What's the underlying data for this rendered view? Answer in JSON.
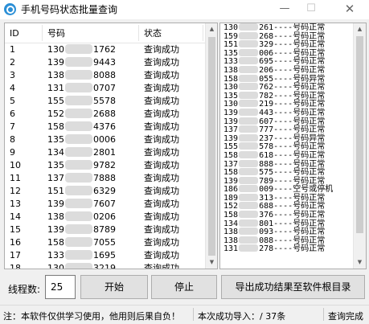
{
  "window": {
    "title": "手机号码状态批量查询",
    "minimize": "—",
    "maximize": "☐",
    "close": "✕",
    "icon": "app-search-icon"
  },
  "table": {
    "headers": [
      "ID",
      "号码",
      "状态"
    ],
    "rows": [
      {
        "id": "1",
        "prefix": "130",
        "suffix": "1762",
        "status": "查询成功"
      },
      {
        "id": "2",
        "prefix": "139",
        "suffix": "9443",
        "status": "查询成功"
      },
      {
        "id": "3",
        "prefix": "138",
        "suffix": "8088",
        "status": "查询成功"
      },
      {
        "id": "4",
        "prefix": "131",
        "suffix": "0707",
        "status": "查询成功"
      },
      {
        "id": "5",
        "prefix": "155",
        "suffix": "5578",
        "status": "查询成功"
      },
      {
        "id": "6",
        "prefix": "152",
        "suffix": "2688",
        "status": "查询成功"
      },
      {
        "id": "7",
        "prefix": "158",
        "suffix": "4376",
        "status": "查询成功"
      },
      {
        "id": "8",
        "prefix": "135",
        "suffix": "0006",
        "status": "查询成功"
      },
      {
        "id": "9",
        "prefix": "134",
        "suffix": "2801",
        "status": "查询成功"
      },
      {
        "id": "10",
        "prefix": "135",
        "suffix": "9782",
        "status": "查询成功"
      },
      {
        "id": "11",
        "prefix": "137",
        "suffix": "7888",
        "status": "查询成功"
      },
      {
        "id": "12",
        "prefix": "151",
        "suffix": "6329",
        "status": "查询成功"
      },
      {
        "id": "13",
        "prefix": "139",
        "suffix": "7607",
        "status": "查询成功"
      },
      {
        "id": "14",
        "prefix": "138",
        "suffix": "0206",
        "status": "查询成功"
      },
      {
        "id": "15",
        "prefix": "139",
        "suffix": "8789",
        "status": "查询成功"
      },
      {
        "id": "16",
        "prefix": "158",
        "suffix": "7055",
        "status": "查询成功"
      },
      {
        "id": "17",
        "prefix": "133",
        "suffix": "1695",
        "status": "查询成功"
      },
      {
        "id": "18",
        "prefix": "130",
        "suffix": "3219",
        "status": "查询成功"
      }
    ]
  },
  "results": [
    {
      "prefix": "130",
      "suffix": "261",
      "status": "号码正常"
    },
    {
      "prefix": "159",
      "suffix": "268",
      "status": "号码正常"
    },
    {
      "prefix": "151",
      "suffix": "329",
      "status": "号码正常"
    },
    {
      "prefix": "135",
      "suffix": "006",
      "status": "号码正常"
    },
    {
      "prefix": "133",
      "suffix": "695",
      "status": "号码正常"
    },
    {
      "prefix": "138",
      "suffix": "206",
      "status": "号码正常"
    },
    {
      "prefix": "158",
      "suffix": "055",
      "status": "号码异常"
    },
    {
      "prefix": "130",
      "suffix": "762",
      "status": "号码正常"
    },
    {
      "prefix": "135",
      "suffix": "782",
      "status": "号码正常"
    },
    {
      "prefix": "130",
      "suffix": "219",
      "status": "号码正常"
    },
    {
      "prefix": "139",
      "suffix": "443",
      "status": "号码正常"
    },
    {
      "prefix": "139",
      "suffix": "607",
      "status": "号码正常"
    },
    {
      "prefix": "137",
      "suffix": "777",
      "status": "号码正常"
    },
    {
      "prefix": "139",
      "suffix": "237",
      "status": "号码异常"
    },
    {
      "prefix": "155",
      "suffix": "578",
      "status": "号码正常"
    },
    {
      "prefix": "158",
      "suffix": "618",
      "status": "号码正常"
    },
    {
      "prefix": "137",
      "suffix": "888",
      "status": "号码正常"
    },
    {
      "prefix": "158",
      "suffix": "575",
      "status": "号码正常"
    },
    {
      "prefix": "139",
      "suffix": "789",
      "status": "号码正常"
    },
    {
      "prefix": "186",
      "suffix": "009",
      "status": "空号或停机"
    },
    {
      "prefix": "189",
      "suffix": "313",
      "status": "号码正常"
    },
    {
      "prefix": "152",
      "suffix": "688",
      "status": "号码正常"
    },
    {
      "prefix": "158",
      "suffix": "376",
      "status": "号码正常"
    },
    {
      "prefix": "134",
      "suffix": "801",
      "status": "号码正常"
    },
    {
      "prefix": "138",
      "suffix": "093",
      "status": "号码正常"
    },
    {
      "prefix": "138",
      "suffix": "088",
      "status": "号码正常"
    },
    {
      "prefix": "131",
      "suffix": "278",
      "status": "号码正常"
    }
  ],
  "controls": {
    "threads_label": "线程数:",
    "threads_value": "25",
    "start_label": "开始",
    "stop_label": "停止",
    "export_label": "导出成功结果至软件根目录"
  },
  "status": {
    "note": "注：本软件仅供学习使用，他用则后果自负！",
    "progress": "本次成功导入：/ 37条",
    "state": "查询完成"
  }
}
